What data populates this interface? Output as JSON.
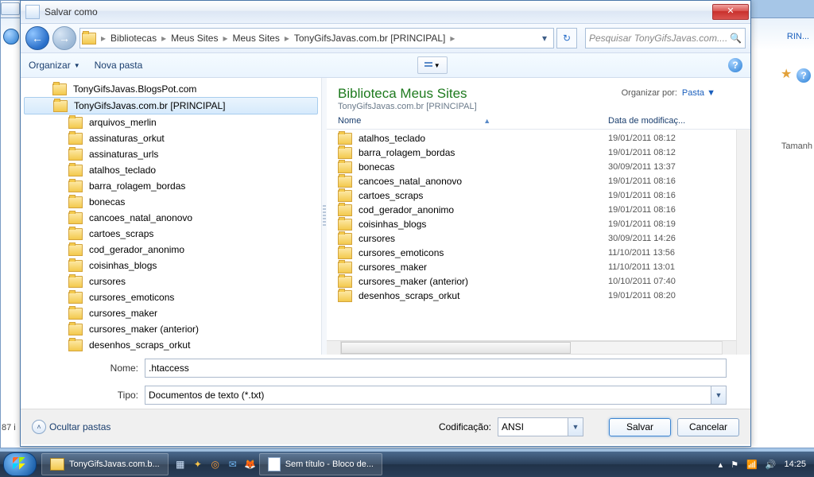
{
  "window": {
    "title": "Salvar como"
  },
  "bg": {
    "tab1": "RIN...",
    "tab2": "...",
    "side": "Tamanh",
    "corner": "87 i"
  },
  "path": [
    "Bibliotecas",
    "Meus Sites",
    "Meus Sites",
    "TonyGifsJavas.com.br [PRINCIPAL]"
  ],
  "search": {
    "placeholder": "Pesquisar TonyGifsJavas.com...."
  },
  "toolbar": {
    "organize": "Organizar",
    "newfolder": "Nova pasta"
  },
  "lib": {
    "title": "Biblioteca Meus Sites",
    "sub": "TonyGifsJavas.com.br [PRINCIPAL]",
    "orgby": "Organizar por:",
    "orgval": "Pasta"
  },
  "cols": {
    "name": "Nome",
    "date": "Data de modificaç..."
  },
  "tree": [
    {
      "indent": 2,
      "label": "TonyGifsJavas.BlogsPot.com",
      "sel": false
    },
    {
      "indent": 2,
      "label": "TonyGifsJavas.com.br [PRINCIPAL]",
      "sel": true
    },
    {
      "indent": 3,
      "label": "arquivos_merlin"
    },
    {
      "indent": 3,
      "label": "assinaturas_orkut"
    },
    {
      "indent": 3,
      "label": "assinaturas_urls"
    },
    {
      "indent": 3,
      "label": "atalhos_teclado"
    },
    {
      "indent": 3,
      "label": "barra_rolagem_bordas"
    },
    {
      "indent": 3,
      "label": "bonecas"
    },
    {
      "indent": 3,
      "label": "cancoes_natal_anonovo"
    },
    {
      "indent": 3,
      "label": "cartoes_scraps"
    },
    {
      "indent": 3,
      "label": "cod_gerador_anonimo"
    },
    {
      "indent": 3,
      "label": "coisinhas_blogs"
    },
    {
      "indent": 3,
      "label": "cursores"
    },
    {
      "indent": 3,
      "label": "cursores_emoticons"
    },
    {
      "indent": 3,
      "label": "cursores_maker"
    },
    {
      "indent": 3,
      "label": "cursores_maker (anterior)"
    },
    {
      "indent": 3,
      "label": "desenhos_scraps_orkut"
    }
  ],
  "files": [
    {
      "name": "atalhos_teclado",
      "date": "19/01/2011 08:12"
    },
    {
      "name": "barra_rolagem_bordas",
      "date": "19/01/2011 08:12"
    },
    {
      "name": "bonecas",
      "date": "30/09/2011 13:37"
    },
    {
      "name": "cancoes_natal_anonovo",
      "date": "19/01/2011 08:16"
    },
    {
      "name": "cartoes_scraps",
      "date": "19/01/2011 08:16"
    },
    {
      "name": "cod_gerador_anonimo",
      "date": "19/01/2011 08:16"
    },
    {
      "name": "coisinhas_blogs",
      "date": "19/01/2011 08:19"
    },
    {
      "name": "cursores",
      "date": "30/09/2011 14:26"
    },
    {
      "name": "cursores_emoticons",
      "date": "11/10/2011 13:56"
    },
    {
      "name": "cursores_maker",
      "date": "11/10/2011 13:01"
    },
    {
      "name": "cursores_maker (anterior)",
      "date": "10/10/2011 07:40"
    },
    {
      "name": "desenhos_scraps_orkut",
      "date": "19/01/2011 08:20"
    }
  ],
  "form": {
    "name_lbl": "Nome:",
    "name_val": ".htaccess",
    "type_lbl": "Tipo:",
    "type_val": "Documentos de texto (*.txt)"
  },
  "bottom": {
    "hide": "Ocultar pastas",
    "enc_lbl": "Codificação:",
    "enc_val": "ANSI",
    "save": "Salvar",
    "cancel": "Cancelar"
  },
  "taskbar": {
    "task1": "TonyGifsJavas.com.b...",
    "task2": "Sem título - Bloco de...",
    "clock": "14:25"
  }
}
